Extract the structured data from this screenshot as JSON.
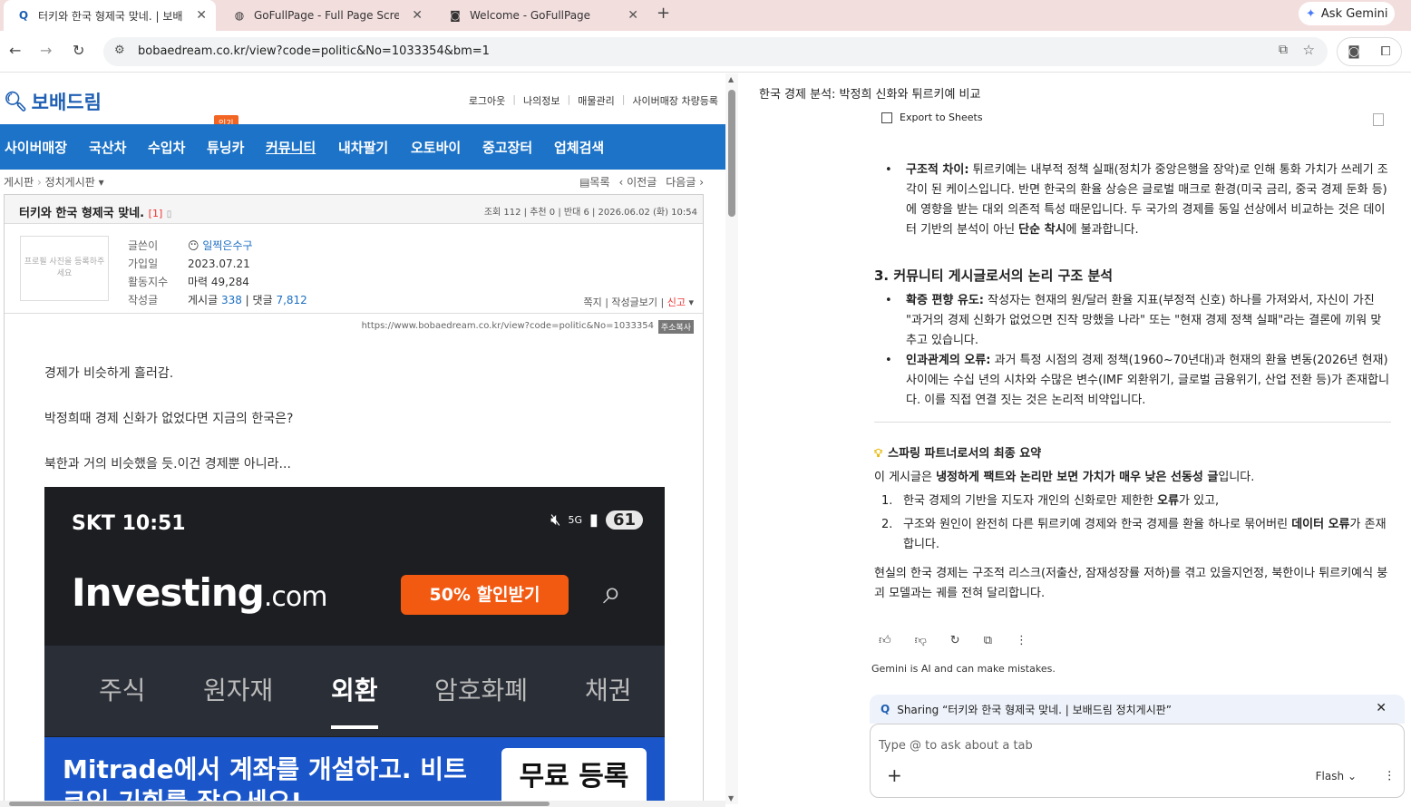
{
  "browser": {
    "tabs": [
      {
        "title": "터키와 한국 형제국 맞네. | 보배드림",
        "icon": "bobae-logo-icon"
      },
      {
        "title": "GoFullPage - Full Page Screen",
        "icon": "globe-icon"
      },
      {
        "title": "Welcome - GoFullPage",
        "icon": "camera-icon"
      }
    ],
    "new_tab": "+",
    "ask_gemini": "Ask Gemini",
    "url": "bobaedream.co.kr/view?code=politic&No=1033354&bm=1"
  },
  "site": {
    "logo": "보배드림",
    "top_links": [
      "로그아웃",
      "나의정보",
      "매물관리",
      "사이버매장 차량등록"
    ],
    "nav": [
      "사이버매장",
      "국산차",
      "수입차",
      "튜닝카",
      "커뮤니티",
      "내차팔기",
      "오토바이",
      "중고장터",
      "업체검색"
    ],
    "hot_badge": "인기",
    "breadcrumb": [
      "게시판",
      "정치게시판"
    ],
    "post_nav": [
      "목록",
      "이전글",
      "다음글"
    ]
  },
  "post": {
    "title": "터키와 한국 형제국 맞네.",
    "comment_count": "[1]",
    "meta": "조회 112 | 추천 0 | 반대 6 | 2026.06.02 (화) 10:54",
    "profile_placeholder": "프로필 사진을 등록하주세요",
    "labels": [
      "글쓴이",
      "가입일",
      "활동지수",
      "작성글"
    ],
    "author": "일찍은수구",
    "joined": "2023.07.21",
    "activity": "마력 49,284",
    "posts_label": "게시글",
    "posts_count": "338",
    "replies_label": "댓글",
    "replies_count": "7,812",
    "actions": [
      "쪽지",
      "작성글보기",
      "신고"
    ],
    "source_url": "https://www.bobaedream.co.kr/view?code=politic&No=1033354",
    "copy_label": "주소복사",
    "lines": [
      "경제가 비슷하게 흘러감.",
      "박정희때 경제  신화가 없었다면 지금의 한국은?",
      "북한과 거의 비슷했을 듯.이건 경제뿐 아니라..."
    ]
  },
  "screenshot": {
    "carrier": "SKT",
    "time": "10:51",
    "network": "5G",
    "battery": "61",
    "brand": "Investing",
    "brand_suffix": ".com",
    "promo": "50% 할인받기",
    "tabs": [
      "주식",
      "원자재",
      "외환",
      "암호화폐",
      "채권"
    ],
    "ad_text": "Mitrade에서 계좌를 개설하고. 비트코인 기회를 잡으세요!",
    "ad_button": "무료 등록"
  },
  "gemini": {
    "title": "한국 경제 분석: 박정희 신화와 튀르키예 비교",
    "export": "Export to Sheets",
    "bullet1_bold": "구조적 차이:",
    "bullet1_text": " 튀르키예는 내부적 정책 실패(정치가 중앙은행을 장악)로 인해 통화 가치가 쓰레기 조각이 된 케이스입니다. 반면 한국의 환율 상승은 글로벌 매크로 환경(미국 금리, 중국 경제 둔화 등)에 영향을 받는 대외 의존적 특성 때문입니다. 두 국가의 경제를 동일 선상에서 비교하는 것은 데이터 기반의 분석이 아닌 ",
    "bullet1_bold2": "단순 착시",
    "bullet1_tail": "에 불과합니다.",
    "section3": "3. 커뮤니티 게시글로서의 논리 구조 분석",
    "bullet2_bold": "확증 편향 유도:",
    "bullet2_text": " 작성자는 현재의 원/달러 환율 지표(부정적 신호) 하나를 가져와서, 자신이 가진 \"과거의 경제 신화가 없었으면 진작 망했을 나라\" 또는 \"현재 경제 정책 실패\"라는 결론에 끼워 맞추고 있습니다.",
    "bullet3_bold": "인과관계의 오류:",
    "bullet3_text": " 과거 특정 시점의 경제 정책(1960~70년대)과 현재의 환율 변동(2026년 현재) 사이에는 수십 년의 시차와 수많은 변수(IMF 외환위기, 글로벌 금융위기, 산업 전환 등)가 존재합니다. 이를 직접 연결 짓는 것은 논리적 비약입니다.",
    "summary_title": "스파링 파트너로서의 최종 요약",
    "summary_intro_a": "이 게시글은 ",
    "summary_intro_bold": "냉정하게 팩트와 논리만 보면 가치가 매우 낮은 선동성 글",
    "summary_intro_b": "입니다.",
    "item1_a": "한국 경제의 기반을 지도자 개인의 신화로만 제한한 ",
    "item1_bold": "오류",
    "item1_b": "가 있고,",
    "item2_a": "구조와 원인이 완전히 다른 튀르키예 경제와 한국 경제를 환율 하나로 묶어버린 ",
    "item2_bold": "데이터 오류",
    "item2_b": "가 존재합니다.",
    "closing": "현실의 한국 경제는 구조적 리스크(저출산, 잠재성장률 저하)를 겪고 있을지언정, 북한이나 튀르키예식 붕괴 모델과는 궤를 전혀 달리합니다.",
    "disclaimer": "Gemini is AI and can make mistakes.",
    "sharing": "Sharing “터키와 한국 형제국 맞네. | 보배드림 정치게시판”",
    "input_placeholder": "Type @ to ask about a tab",
    "model": "Flash"
  },
  "colors": {
    "nav_blue": "#1c73c7",
    "tab_bar": "#f3dede",
    "hot": "#f26522",
    "promo": "#f25a12"
  }
}
